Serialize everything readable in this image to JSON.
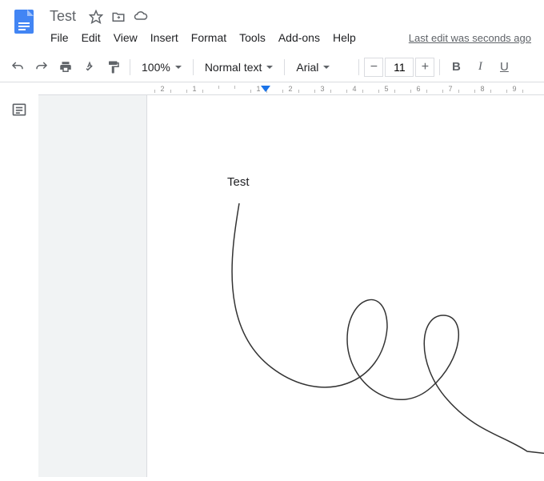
{
  "header": {
    "title": "Test",
    "last_edit": "Last edit was seconds ago"
  },
  "menubar": {
    "file": "File",
    "edit": "Edit",
    "view": "View",
    "insert": "Insert",
    "format": "Format",
    "tools": "Tools",
    "addons": "Add-ons",
    "help": "Help"
  },
  "toolbar": {
    "zoom": "100%",
    "style": "Normal text",
    "font": "Arial",
    "font_size": "11",
    "bold": "B",
    "italic": "I",
    "underline": "U"
  },
  "ruler": {
    "ticks": [
      "2",
      "1",
      "",
      "1",
      "2",
      "3",
      "4",
      "5",
      "6",
      "7",
      "8",
      "9"
    ]
  },
  "document": {
    "body_text": "Test"
  }
}
